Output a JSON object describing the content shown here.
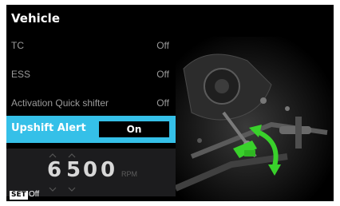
{
  "header": {
    "title": "Vehicle"
  },
  "menu": {
    "items": [
      {
        "label": "TC",
        "value": "Off"
      },
      {
        "label": "ESS",
        "value": "Off"
      },
      {
        "label": "Activation Quick shifter",
        "value": "Off"
      },
      {
        "label": "Upshift Alert",
        "value": "On"
      }
    ]
  },
  "rpm": {
    "digits": [
      "6",
      "5",
      "0",
      "0"
    ],
    "unit": "RPM"
  },
  "footer": {
    "set_label": "SET",
    "set_value": "Off"
  },
  "status": {
    "big": "ON"
  },
  "colors": {
    "accent": "#35c0e8",
    "arrow": "#39d12b"
  },
  "icons": {
    "bike": "motorcycle-shifter-illustration",
    "arrow": "curved-double-arrow-icon"
  }
}
